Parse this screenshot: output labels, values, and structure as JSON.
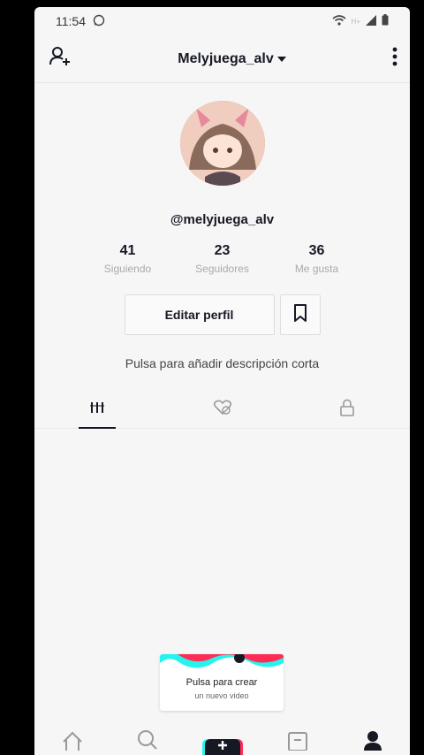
{
  "status": {
    "time": "11:54",
    "network": "H+"
  },
  "header": {
    "username": "Melyjuega_alv"
  },
  "profile": {
    "handle": "@melyjuega_alv",
    "stats": [
      {
        "value": "41",
        "label": "Siguiendo"
      },
      {
        "value": "23",
        "label": "Seguidores"
      },
      {
        "value": "36",
        "label": "Me gusta"
      }
    ],
    "edit_label": "Editar perfil",
    "bio_prompt": "Pulsa para añadir descripción corta"
  },
  "create_tip": {
    "title": "Pulsa para crear",
    "subtitle": "un nuevo video"
  },
  "colors": {
    "accent_cyan": "#25f4ee",
    "accent_red": "#fe2c55",
    "text": "#161823"
  }
}
